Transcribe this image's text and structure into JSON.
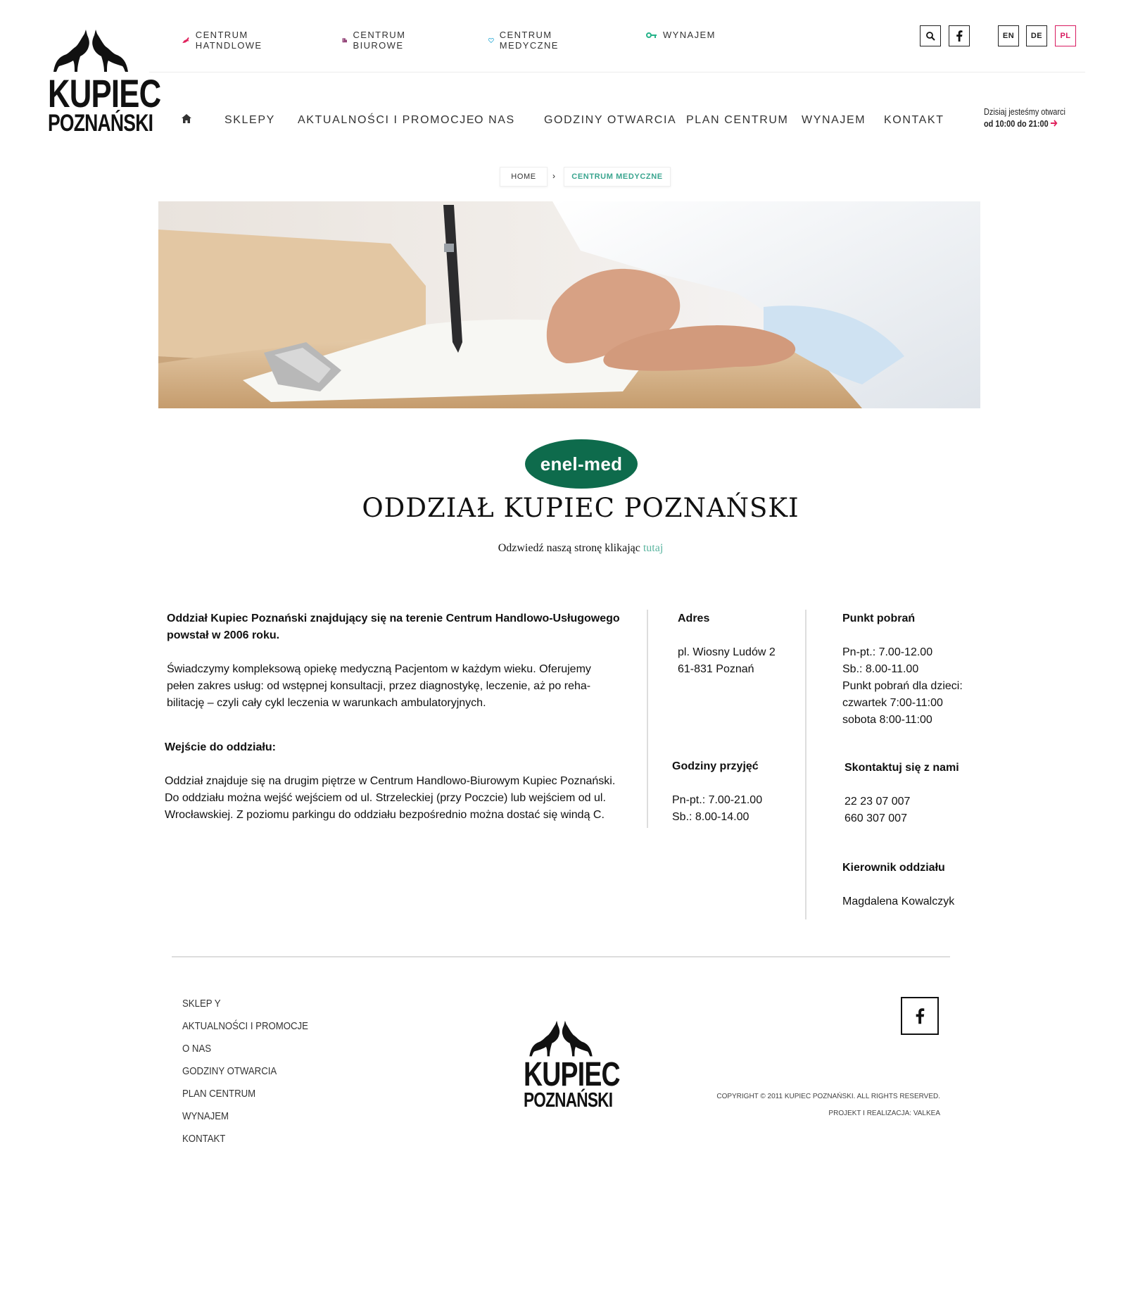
{
  "brand": {
    "line1": "KUPIEC",
    "line2": "POZNAŃSKI"
  },
  "topbar": {
    "items": [
      {
        "label": "CENTRUM HATNDLOWE",
        "icon": "horse-icon",
        "color": "#e0245e"
      },
      {
        "label": "CENTRUM BIUROWE",
        "icon": "building-icon",
        "color": "#8e3b72"
      },
      {
        "label": "CENTRUM MEDYCZNE",
        "icon": "heart-icon",
        "color": "#3ab0d8"
      },
      {
        "label": "WYNAJEM",
        "icon": "key-icon",
        "color": "#26b38a"
      }
    ],
    "languages": [
      "EN",
      "DE",
      "PL"
    ],
    "active_language": "PL"
  },
  "nav": {
    "items": [
      "SKLEPY",
      "AKTUALNOŚCI I PROMOCJE",
      "O NAS",
      "GODZINY OTWARCIA",
      "PLAN CENTRUM",
      "WYNAJEM",
      "KONTAKT"
    ],
    "today_line1": "Dzisiaj jesteśmy otwarci",
    "today_line2": "od 10:00 do 21:00"
  },
  "breadcrumb": {
    "home": "HOME",
    "separator": "›",
    "current": "CENTRUM MEDYCZNE"
  },
  "clinic": {
    "logo_text": "enel-med",
    "title": "ODDZIAŁ KUPIEC POZNAŃSKI",
    "visit_text": "Odzwiedź naszą stronę klikając",
    "visit_link": "tutaj"
  },
  "content": {
    "intro_bold_1": "Oddział Kupiec Poznański znajdujący się na terenie Centrum Handlowo-Usługowego",
    "intro_bold_2": "powstał w 2006 roku.",
    "intro_1": "Świadczymy kompleksową opiekę medyczną Pacjentom w każdym wieku. Oferujemy",
    "intro_2": "pełen zakres usług:  od wstępnej konsultacji, przez diagnostykę, leczenie, aż po reha-",
    "intro_3": "bilitację – czyli cały cykl leczenia w warunkach ambulatoryjnych.",
    "entrance_title": "Wejście do oddziału:",
    "entrance_1": "Oddział znajduje się na drugim piętrze w Centrum Handlowo-Biurowym Kupiec Poznański.",
    "entrance_2": "Do oddziału można wejść wejściem od ul. Strzeleckiej (przy Poczcie) lub wejściem od ul.",
    "entrance_3": "Wrocławskiej. Z poziomu parkingu do oddziału bezpośrednio można dostać się windą C.",
    "address_title": "Adres",
    "address_1": "pl. Wiosny Ludów 2",
    "address_2": "61-831 Poznań",
    "hours_title": "Godziny przyjęć",
    "hours_1": "Pn-pt.: 7.00-21.00",
    "hours_2": "Sb.: 8.00-14.00",
    "lab_title": "Punkt pobrań",
    "lab_1": "Pn-pt.: 7.00-12.00",
    "lab_2": "Sb.: 8.00-11.00",
    "lab_3": "Punkt pobrań dla dzieci:",
    "lab_4": "czwartek 7:00-11:00",
    "lab_5": "sobota 8:00-11:00",
    "contact_title": "Skontaktuj się z nami",
    "contact_1": "22 23 07 007",
    "contact_2": "660 307 007",
    "manager_title": "Kierownik oddziału",
    "manager_name": "Magdalena Kowalczyk"
  },
  "footer": {
    "links": [
      "SKLEP Y",
      "AKTUALNOŚCI I PROMOCJE",
      "O NAS",
      "GODZINY OTWARCIA",
      "PLAN CENTRUM",
      "WYNAJEM",
      "KONTAKT"
    ],
    "copyright": "COPYRIGHT © 2011 KUPIEC POZNAŃSKI. ALL RIGHTS RESERVED.",
    "credits": "PROJEKT I REALIZACJA: VALKEA"
  }
}
